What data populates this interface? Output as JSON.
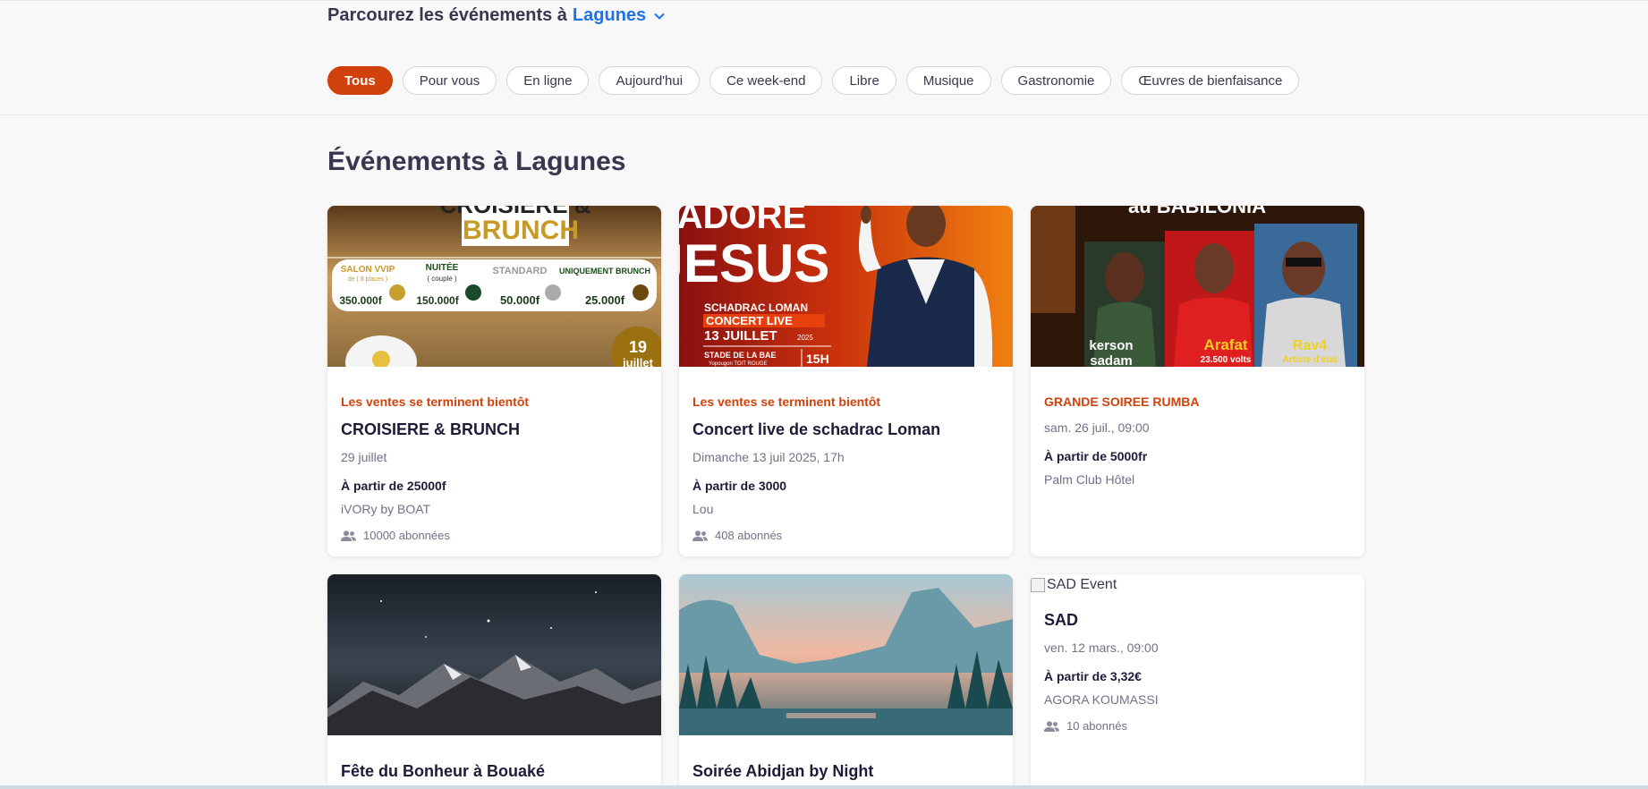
{
  "header": {
    "browse_prefix": "Parcourez les événements à",
    "location": "Lagunes"
  },
  "filters": [
    "Tous",
    "Pour vous",
    "En ligne",
    "Aujourd'hui",
    "Ce week-end",
    "Libre",
    "Musique",
    "Gastronomie",
    "Œuvres de bienfaisance"
  ],
  "section": {
    "title": "Événements à Lagunes"
  },
  "cards": [
    {
      "tag": "Les ventes se terminent bientôt",
      "title": "CROISIERE & BRUNCH",
      "date": "29 juillet",
      "price": "À partir de 25000f",
      "organizer": "iVORy by BOAT",
      "followers": "10000 abonnées",
      "img_texts": {
        "t1": "CROISIERE &",
        "t2": "BRUNCH",
        "p1a": "SALON VVIP",
        "p1b": "de ( 8 places )",
        "p1c": "350.000f",
        "p2a": "NUITÉE",
        "p2b": "( couple )",
        "p2c": "150.000f",
        "p3a": "STANDARD",
        "p3c": "50.000f",
        "p4a": "UNIQUEMENT BRUNCH",
        "p4c": "25.000f",
        "day": "19",
        "month": "juillet"
      }
    },
    {
      "tag": "Les ventes se terminent bientôt",
      "title": "Concert live de schadrac Loman",
      "date": "Dimanche 13 juil 2025, 17h",
      "price": "À partir de 3000",
      "organizer": "Lou",
      "followers": "408 abonnés",
      "img_texts": {
        "t1": "ADORE",
        "t2": "JESUS",
        "l1": "SCHADRAC LOMAN",
        "l2": "CONCERT LIVE",
        "l3": "13 JUILLET",
        "l3b": "2025",
        "l4": "STADE DE LA BAE",
        "l4b": "Yopougon TOIT ROUGE",
        "l5": "15H"
      }
    },
    {
      "tag": "GRANDE SOIREE RUMBA",
      "date": "sam. 26 juil., 09:00",
      "price": "À partir de 5000fr",
      "organizer": "Palm Club Hôtel",
      "img_texts": {
        "top": "au BABILONIA",
        "a1": "kerson",
        "a1b": "sadam",
        "a2": "Arafat",
        "a2b": "23.500 volts",
        "a3": "Rav4",
        "a3b": "Artiste d'état"
      }
    },
    {
      "title": "Fête du Bonheur à Bouaké"
    },
    {
      "title": "Soirée Abidjan by Night"
    },
    {
      "img_alt": "SAD Event",
      "title": "SAD",
      "date": "ven. 12 mars., 09:00",
      "price": "À partir de 3,32€",
      "organizer": "AGORA KOUMASSI",
      "followers": "10 abonnés"
    }
  ],
  "colors": {
    "accent": "#d1410c",
    "link": "#1e73e8",
    "text": "#39364f"
  }
}
